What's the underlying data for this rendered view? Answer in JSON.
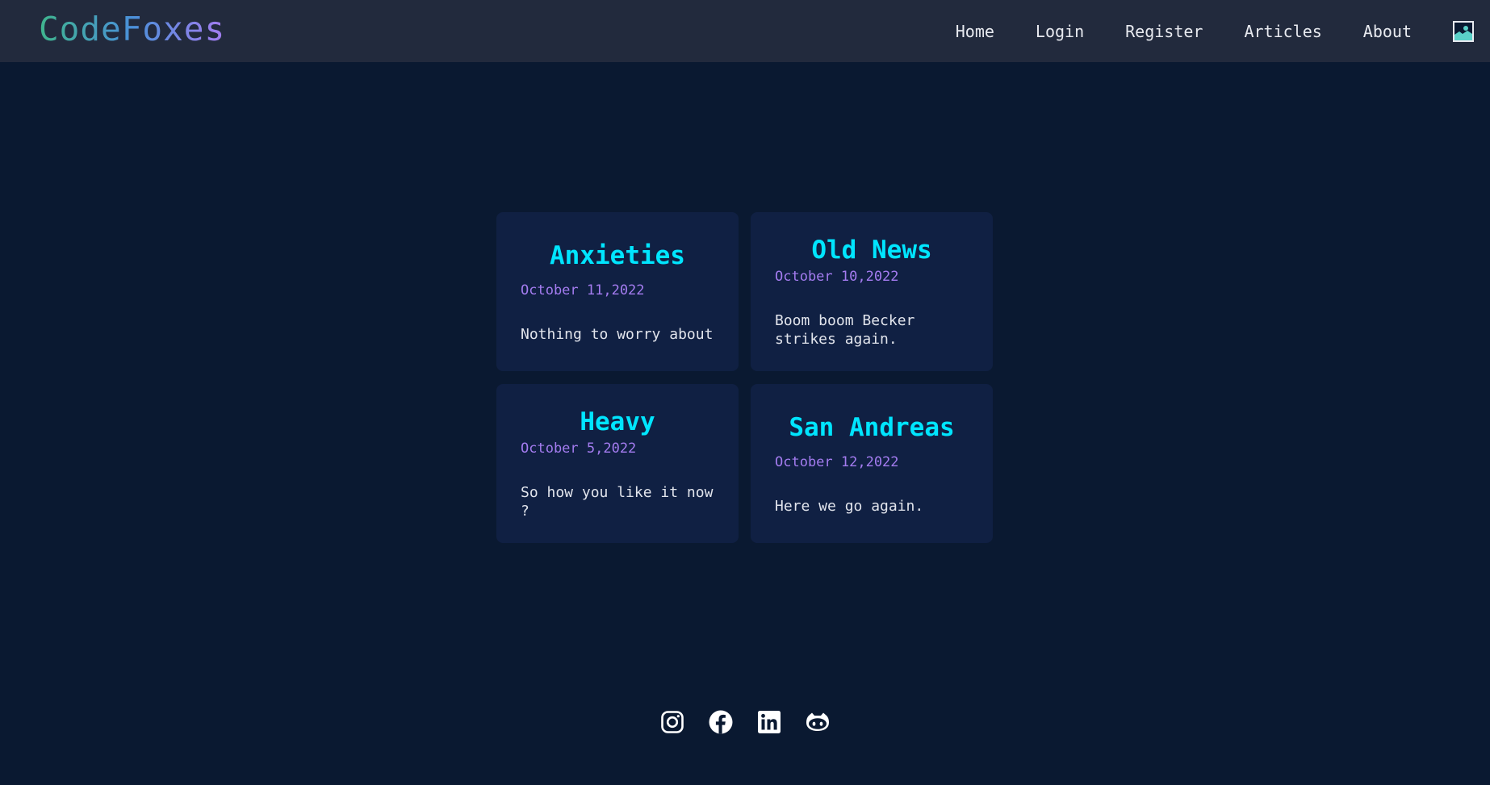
{
  "header": {
    "logo": "CodeFoxes",
    "nav": [
      {
        "label": "Home"
      },
      {
        "label": "Login"
      },
      {
        "label": "Register"
      },
      {
        "label": "Articles"
      },
      {
        "label": "About"
      }
    ],
    "profile_icon": "image-icon"
  },
  "articles": [
    {
      "title": "Anxieties",
      "date": "October 11,2022",
      "text": "Nothing to worry about"
    },
    {
      "title": "Old News",
      "date": "October 10,2022",
      "text": "Boom boom Becker strikes again."
    },
    {
      "title": "Heavy",
      "date": "October 5,2022",
      "text": "So how you like it now ?"
    },
    {
      "title": "San Andreas",
      "date": "October 12,2022",
      "text": "Here we go again."
    }
  ],
  "footer": {
    "socials": [
      "instagram-icon",
      "facebook-icon",
      "linkedin-icon",
      "github-icon"
    ]
  },
  "colors": {
    "background": "#0a1931",
    "navbar": "#222a3d",
    "card": "#102043",
    "title": "#00e5ff",
    "date": "#a47cf0",
    "text": "#e1e4ec"
  }
}
